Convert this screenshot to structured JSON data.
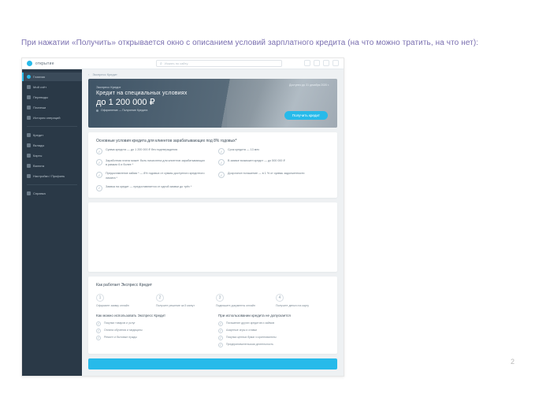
{
  "caption": "При нажатии «Получить» открывается окно с описанием условий зарплатного кредита (на что можно тратить, на что нет):",
  "page_number": "2",
  "brand": "открытие",
  "search_placeholder": "Искать по сайту",
  "sidebar": {
    "items": [
      {
        "label": "Главная",
        "active": true
      },
      {
        "label": "Мой счёт"
      },
      {
        "label": "Переводы"
      },
      {
        "label": "Платежи"
      },
      {
        "label": "История операций"
      }
    ],
    "items2": [
      {
        "label": "Кредит"
      },
      {
        "label": "Вклады"
      },
      {
        "label": "Карты"
      },
      {
        "label": "Валюта"
      },
      {
        "label": "Настройки / Профиль"
      }
    ],
    "items3": [
      {
        "label": "Справка"
      }
    ]
  },
  "breadcrumb": {
    "back": "‹",
    "label": "Экспресс Кредит"
  },
  "hero": {
    "top_badge": "Доступно до 31 декабря 2020 г.",
    "tag": "Экспресс Кредит",
    "title": "Кредит на специальных условиях",
    "amount": "до 1 200 000 ₽",
    "sub": "Оформление — Получение Кредита",
    "cta": "Получить кредит"
  },
  "conditions": {
    "title": "Основные условия кредита для клиентов зарабатывающих под 8% годовых*",
    "features": [
      "Сумма кредита — до 1 200 000 ₽ без подтверждения",
      "Срок кредита — 13 мес",
      "Заработная плата может быть начислена для клиентов зарабатывающих в рамках 6 и более *",
      "В заявке возможен кредит — до 500 000 ₽",
      "Предоставление займа * — 8% годовых от суммы доступного кредитного лимита *",
      "Досрочное погашение — в 1 % от суммы задолженности",
      "Заявка на кредит — предоставляется от одной заявки до трёх *"
    ]
  },
  "steps": {
    "title": "Как работает Экспресс Кредит",
    "items": [
      {
        "n": "1",
        "label": "Оформите заявку онлайн"
      },
      {
        "n": "2",
        "label": "Получите решение за 5 минут"
      },
      {
        "n": "3",
        "label": "Подпишите документы онлайн"
      },
      {
        "n": "4",
        "label": "Получите деньги на карту"
      }
    ]
  },
  "usage": {
    "allowed_title": "Как можно использовать Экспресс Кредит",
    "allowed": [
      "Покупки товаров и услуг",
      "Оплата обучения и медицины",
      "Ремонт и бытовые нужды"
    ],
    "denied_title": "При использовании кредита не допускается",
    "denied": [
      "Погашение других кредитов и займов",
      "Азартные игры и ставки",
      "Покупка ценных бумаг и криптовалюты",
      "Предпринимательская деятельность"
    ]
  }
}
